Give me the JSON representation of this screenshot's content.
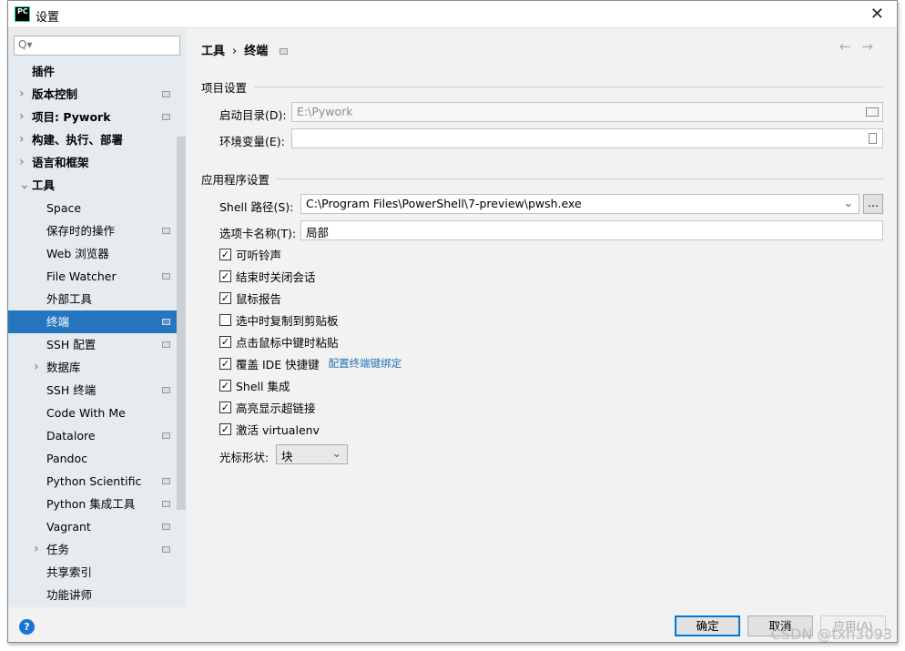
{
  "window": {
    "title": "设置",
    "close": "✕",
    "logo": "PC"
  },
  "search": {
    "placeholder": "Q▾"
  },
  "sidebar": {
    "items": [
      {
        "label": "插件",
        "level": 0,
        "expand": false,
        "gear": false,
        "bold": true
      },
      {
        "label": "版本控制",
        "level": 0,
        "expand": true,
        "gear": true,
        "bold": true
      },
      {
        "label": "项目: Pywork",
        "level": 0,
        "expand": true,
        "gear": true,
        "bold": true
      },
      {
        "label": "构建、执行、部署",
        "level": 0,
        "expand": true,
        "gear": false,
        "bold": true
      },
      {
        "label": "语言和框架",
        "level": 0,
        "expand": true,
        "gear": false,
        "bold": true
      },
      {
        "label": "工具",
        "level": 0,
        "expand": "open",
        "gear": false,
        "bold": true
      },
      {
        "label": "Space",
        "level": 1,
        "gear": false
      },
      {
        "label": "保存时的操作",
        "level": 1,
        "gear": true
      },
      {
        "label": "Web 浏览器",
        "level": 1,
        "gear": false
      },
      {
        "label": "File Watcher",
        "level": 1,
        "gear": true
      },
      {
        "label": "外部工具",
        "level": 1,
        "gear": false
      },
      {
        "label": "终端",
        "level": 1,
        "gear": true,
        "selected": true
      },
      {
        "label": "SSH 配置",
        "level": 1,
        "gear": true
      },
      {
        "label": "数据库",
        "level": 1,
        "expand": true,
        "gear": false
      },
      {
        "label": "SSH 终端",
        "level": 1,
        "gear": true
      },
      {
        "label": "Code With Me",
        "level": 1,
        "gear": false
      },
      {
        "label": "Datalore",
        "level": 1,
        "gear": true
      },
      {
        "label": "Pandoc",
        "level": 1,
        "gear": false
      },
      {
        "label": "Python Scientific",
        "level": 1,
        "gear": true
      },
      {
        "label": "Python 集成工具",
        "level": 1,
        "gear": true
      },
      {
        "label": "Vagrant",
        "level": 1,
        "gear": true
      },
      {
        "label": "任务",
        "level": 1,
        "expand": true,
        "gear": true
      },
      {
        "label": "共享索引",
        "level": 1,
        "gear": false
      },
      {
        "label": "功能讲师",
        "level": 1,
        "gear": false
      }
    ]
  },
  "breadcrumb": [
    "工具",
    "›",
    "终端"
  ],
  "nav": {
    "back": "←",
    "forward": "→"
  },
  "project": {
    "section": "项目设置",
    "start_dir_label": "启动目录(D):",
    "start_dir_value": "E:\\Pywork",
    "env_label": "环境变量(E):",
    "env_value": ""
  },
  "app": {
    "section": "应用程序设置",
    "shell_label": "Shell 路径(S):",
    "shell_value": "C:\\Program Files\\PowerShell\\7-preview\\pwsh.exe",
    "browse": "...",
    "tab_label": "选项卡名称(T):",
    "tab_value": "局部",
    "checkboxes": [
      {
        "label": "可听铃声",
        "checked": true
      },
      {
        "label": "结束时关闭会话",
        "checked": true
      },
      {
        "label": "鼠标报告",
        "checked": true
      },
      {
        "label": "选中时复制到剪贴板",
        "checked": false
      },
      {
        "label": "点击鼠标中键时粘贴",
        "checked": true
      },
      {
        "label": "覆盖 IDE 快捷键",
        "checked": true,
        "link": "配置终端键绑定"
      },
      {
        "label": "Shell 集成",
        "checked": true
      },
      {
        "label": "高亮显示超链接",
        "checked": true
      },
      {
        "label": "激活 virtualenv",
        "checked": true
      }
    ],
    "cursor_label": "光标形状:",
    "cursor_value": "块"
  },
  "buttons": {
    "ok": "确定",
    "cancel": "取消",
    "apply": "应用(A)",
    "help": "?"
  },
  "watermark": "CSDN @txh3093",
  "colors": {
    "selection": "#2675bf",
    "link": "#2470b3",
    "default_button_border": "#0078d7"
  }
}
